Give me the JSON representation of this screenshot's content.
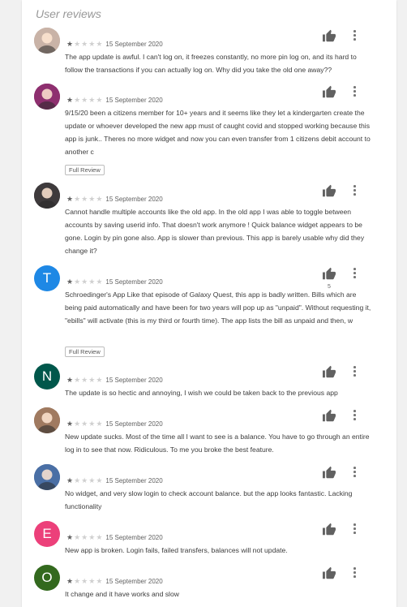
{
  "section_title": "User reviews",
  "reviews": [
    {
      "date": "15 September 2020",
      "stars": 1,
      "avatar": {
        "type": "photo",
        "letter": "",
        "color": "#c9b3a7"
      },
      "text": "The app update is awful. I can't log on, it freezes constantly, no more pin log on, and its hard to follow the transactions if you can actually log on. Why did you take the old one away??",
      "full_review": "",
      "likes": ""
    },
    {
      "date": "15 September 2020",
      "stars": 1,
      "avatar": {
        "type": "photo",
        "letter": "",
        "color": "#8e2f6f"
      },
      "text": "9/15/20 been a citizens member for 10+ years and it seems like they let a kindergarten create the update or whoever developed the new app must of caught covid and stopped working because this app is junk.. Theres no more widget and now you can even transfer from 1 citizens debit account to another c",
      "full_review": "Full Review",
      "likes": ""
    },
    {
      "date": "15 September 2020",
      "stars": 1,
      "avatar": {
        "type": "photo",
        "letter": "",
        "color": "#3e3a3c"
      },
      "text": "Cannot handle multiple accounts like the old app. In the old app I was able to toggle between accounts by saving userid info. That doesn't work anymore ! Quick balance widget appears to be gone. Login by pin gone also. App is slower than previous. This app is barely usable why did they change it?",
      "full_review": "",
      "likes": ""
    },
    {
      "date": "15 September 2020",
      "stars": 1,
      "avatar": {
        "type": "letter",
        "letter": "T",
        "color": "#1e88e5"
      },
      "text": "Schroedinger's App Like that episode of Galaxy Quest, this app is badly written. Bills which are being paid automatically and have been for two years will pop up as \"unpaid\". Without requesting it, \"ebills\" will activate (this is my third or fourth time). The app lists the bill as unpaid and then, w",
      "full_review": "Full Review",
      "likes": "5"
    },
    {
      "date": "15 September 2020",
      "stars": 1,
      "avatar": {
        "type": "letter",
        "letter": "N",
        "color": "#00574b"
      },
      "text": "The update is so hectic and annoying, I wish we could be taken back to the previous app",
      "full_review": "",
      "likes": ""
    },
    {
      "date": "15 September 2020",
      "stars": 1,
      "avatar": {
        "type": "photo",
        "letter": "",
        "color": "#a07a60"
      },
      "text": "New update sucks. Most of the time all I want to see is a balance. You have to go through an entire log in to see that now. Ridiculous. To me you broke the best feature.",
      "full_review": "",
      "likes": ""
    },
    {
      "date": "15 September 2020",
      "stars": 1,
      "avatar": {
        "type": "photo",
        "letter": "",
        "color": "#4a6fa5"
      },
      "text": "No widget, and very slow login to check account balance. but the app looks fantastic. Lacking functionality",
      "full_review": "",
      "likes": ""
    },
    {
      "date": "15 September 2020",
      "stars": 1,
      "avatar": {
        "type": "letter",
        "letter": "E",
        "color": "#ec407a"
      },
      "text": "New app is broken. Login fails, failed transfers, balances will not update.",
      "full_review": "",
      "likes": ""
    },
    {
      "date": "15 September 2020",
      "stars": 1,
      "avatar": {
        "type": "letter",
        "letter": "O",
        "color": "#33691e"
      },
      "text": "It change and it have works and slow",
      "full_review": "",
      "likes": ""
    }
  ]
}
